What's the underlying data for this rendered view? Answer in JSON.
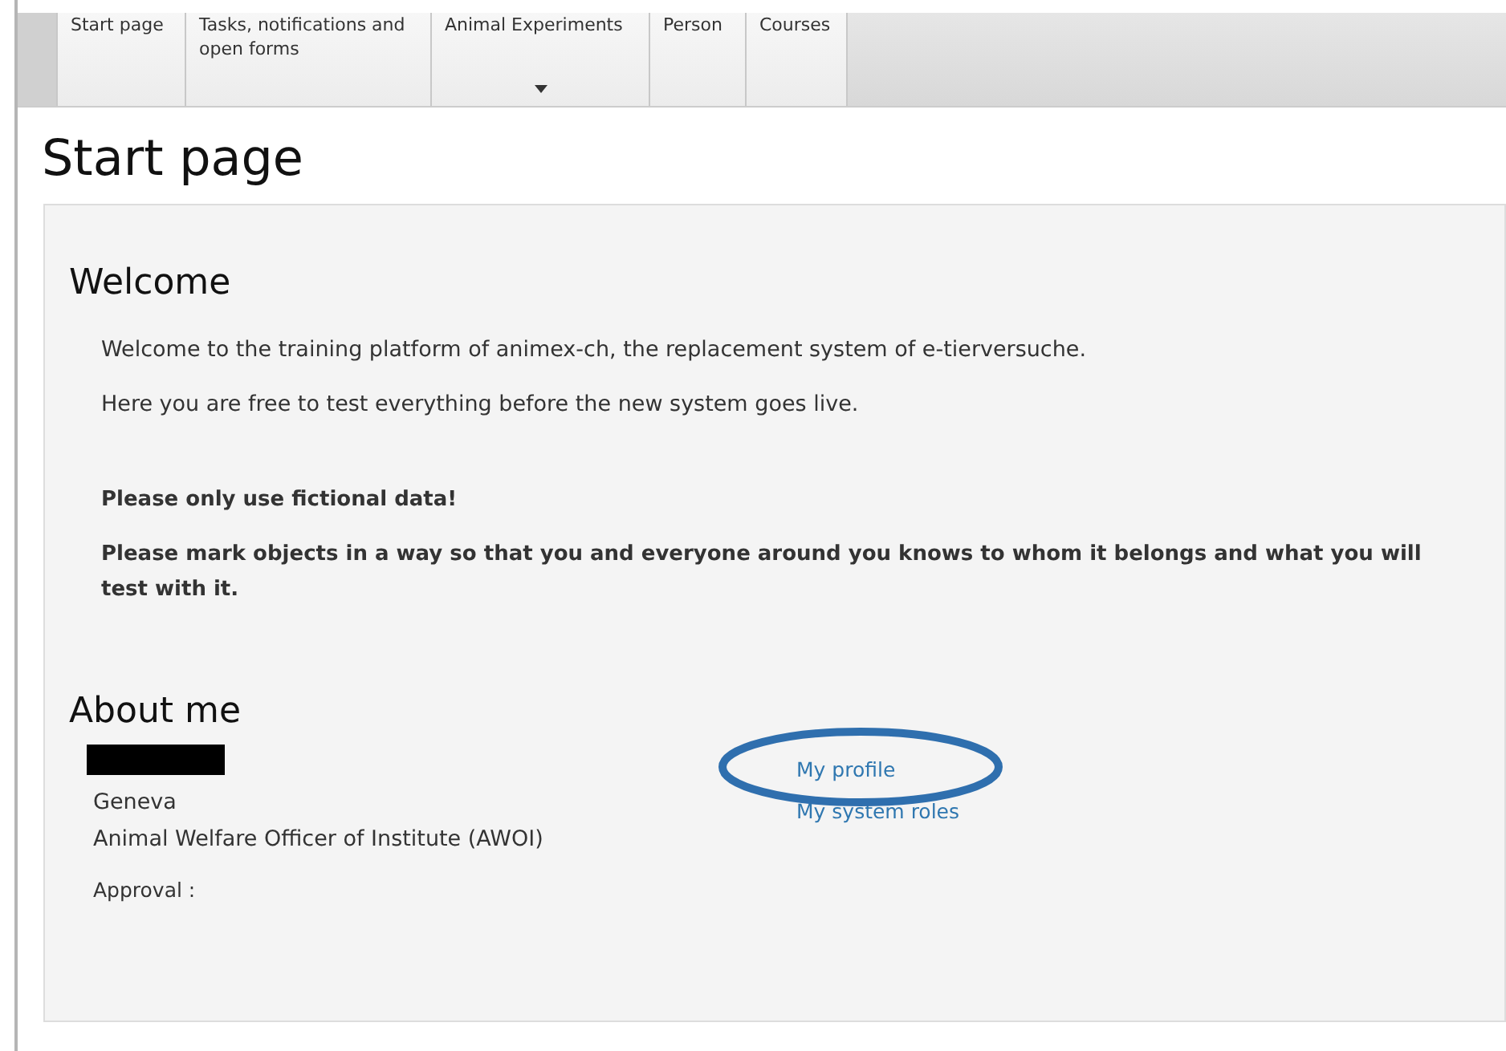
{
  "nav": {
    "tabs": [
      {
        "label": "Start page",
        "dropdown": false
      },
      {
        "label": "Tasks, notifications and open forms",
        "dropdown": false
      },
      {
        "label": "Animal Experiments",
        "dropdown": true
      },
      {
        "label": "Person",
        "dropdown": false
      },
      {
        "label": "Courses",
        "dropdown": false
      }
    ]
  },
  "page_title": "Start page",
  "welcome": {
    "heading": "Welcome",
    "paragraphs": [
      {
        "text": "Welcome to the training platform of animex-ch, the replacement system of e-tierversuche.",
        "bold": false
      },
      {
        "text": "Here you are free to test everything before the new system goes live.",
        "bold": false
      },
      {
        "text": "Please only use fictional data!",
        "bold": true
      },
      {
        "text": "Please mark objects in a way so that you and everyone around you knows to whom it belongs and what you will test with it.",
        "bold": true
      }
    ]
  },
  "about": {
    "heading": "About me",
    "city": "Geneva",
    "role": "Animal Welfare Officer of Institute (AWOI)",
    "approval_label": "Approval :",
    "links": [
      "My profile",
      "My system roles"
    ]
  }
}
